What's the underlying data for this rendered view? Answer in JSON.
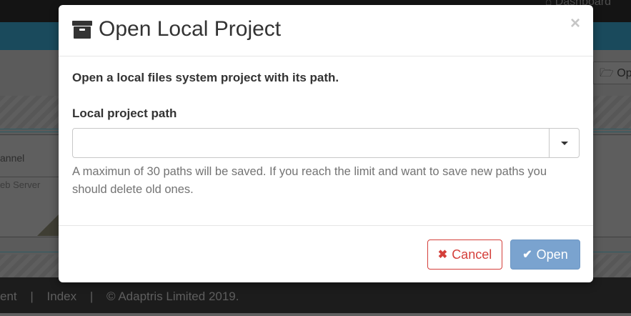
{
  "background": {
    "top_link": "⌂ Dashboard",
    "side_item_channel": "annel",
    "side_item_server": "eb Server",
    "open_button": "🗁 Op",
    "footer": [
      "ent",
      "|",
      "Index",
      "|",
      "© Adaptris Limited 2019."
    ]
  },
  "modal": {
    "title": "Open Local Project",
    "title_icon": "archive-icon",
    "close_label": "×",
    "description": "Open a local files system project with its path.",
    "field_label": "Local project path",
    "path_value": "",
    "path_placeholder": "",
    "help_text": "A maximun of 30 paths will be saved. If you reach the limit and want to save new paths you should delete old ones.",
    "cancel_label": "Cancel",
    "cancel_icon": "✖",
    "open_label": "Open",
    "open_icon": "✔"
  },
  "colors": {
    "danger": "#d43f3a",
    "primary_disabled": "#7aa3cf",
    "overlay": "#5f5f5f"
  }
}
